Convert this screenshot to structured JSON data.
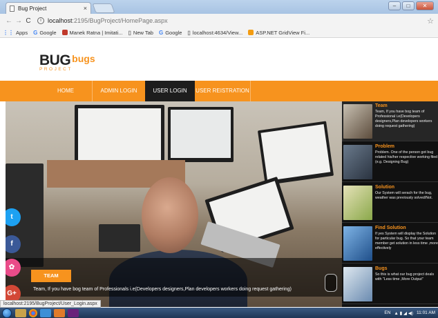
{
  "browser": {
    "tab_title": "Bug Project",
    "tab_close": "×",
    "url_host": "localhost",
    "url_path": ":2195/BugProject/HomePage.aspx",
    "back": "←",
    "forward": "→",
    "reload": "C",
    "bookmarks": [
      {
        "label": "Apps",
        "icon": "apps-grid-icon"
      },
      {
        "label": "Google",
        "icon": "google-icon"
      },
      {
        "label": "Manek Ratna | Imitati...",
        "icon": "site-icon"
      },
      {
        "label": "New Tab",
        "icon": "page-icon"
      },
      {
        "label": "Google",
        "icon": "google-icon"
      },
      {
        "label": "localhost:4634/View...",
        "icon": "page-icon"
      },
      {
        "label": "ASP.NET GridView Fi...",
        "icon": "bookmark-icon"
      }
    ],
    "status_url": "localhost:2195/BugProject/User_Login.aspx"
  },
  "site": {
    "logo_main": "BUG",
    "logo_accent": "bugs",
    "logo_sub": "PROJECT",
    "nav": [
      {
        "label": "HOME",
        "active": false
      },
      {
        "label": "ADMIN LOGIN",
        "active": false
      },
      {
        "label": "USER LOGIN",
        "active": true
      },
      {
        "label": "USER REISTRATION",
        "active": false
      }
    ],
    "slide": {
      "button": "TEAM",
      "caption": "Team, If you have bog team of Professionals i.e(Developers designers,Plan developers workers doing request gathering)"
    },
    "social": [
      "t",
      "f",
      "✿",
      "G+"
    ],
    "sidebar": [
      {
        "title": "Team",
        "text": "Team, If you have bog team of Professional i.e(Developers designers,Plan developers workers doing request gathering)",
        "active": true
      },
      {
        "title": "Problem",
        "text": "Problem. One of the person got bug related his/her respective working filed (e.g. Designing Bug)",
        "active": false
      },
      {
        "title": "Solution",
        "text": "Our System will serach for the bug, weather was previously solved/Not.",
        "active": false
      },
      {
        "title": "Find Solution",
        "text": "If yes System will display the Solution for particular bug. So that your team member get solution in less time ,more effectively",
        "active": false
      },
      {
        "title": "Bugs",
        "text": "So this is what our bug project deals with \"Less time ,More Output\"",
        "active": false
      }
    ]
  },
  "taskbar": {
    "lang": "EN",
    "time": "11:01 AM"
  },
  "colors": {
    "accent": "#f7931e",
    "nav_active": "#1d1d1d",
    "sidebar_bg": "#111111"
  }
}
